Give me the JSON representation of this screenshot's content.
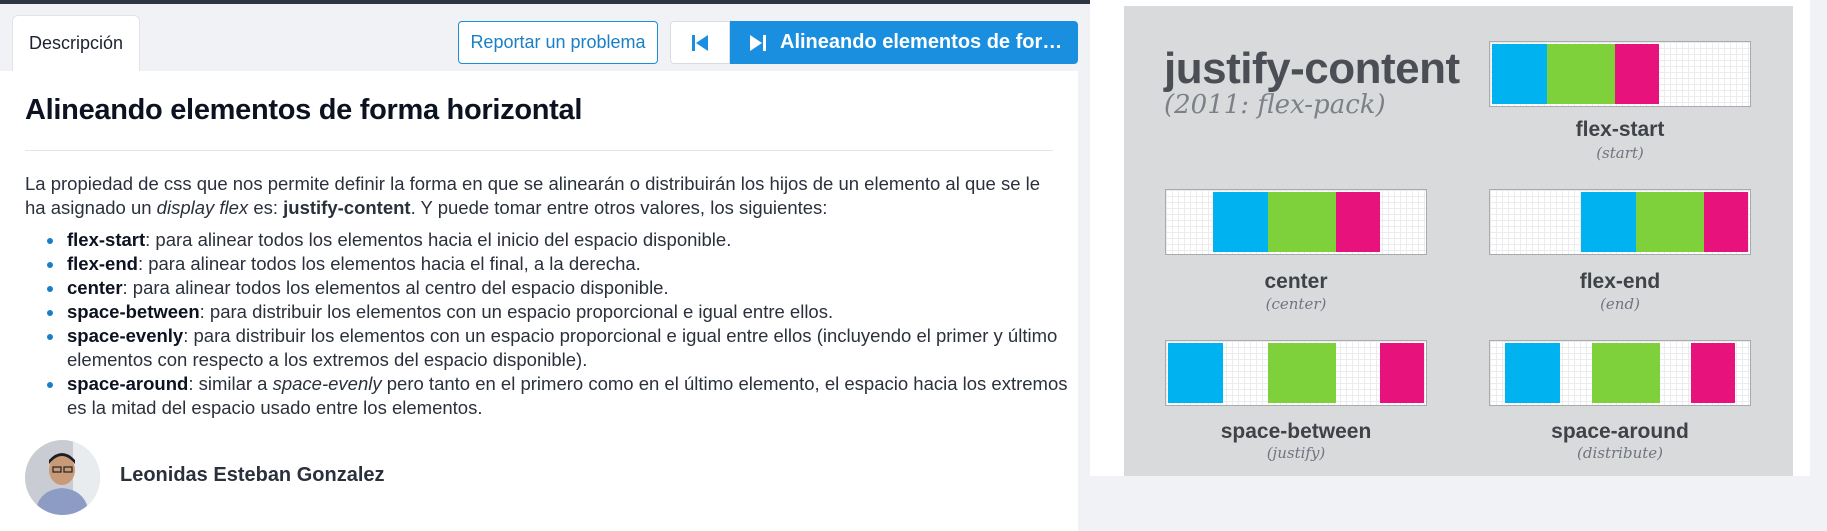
{
  "tabs": {
    "description": "Descripción"
  },
  "toolbar": {
    "report_label": "Reportar un problema",
    "next_label": "Alineando elementos de for…"
  },
  "lesson": {
    "title": "Alineando elementos de forma horizontal",
    "intro_parts": [
      "La propiedad de css que nos permite definir la forma en que se alinearán o distribuirán los hijos de un elemento al que se le ha asignado un ",
      "display flex",
      " es: ",
      "justify-content",
      ". Y puede tomar entre otros valores, los siguientes:"
    ],
    "items": [
      {
        "term": "flex-start",
        "desc": ": para alinear todos los elementos hacia el inicio del espacio disponible."
      },
      {
        "term": "flex-end",
        "desc": ": para alinear todos los elementos hacia el final, a la derecha."
      },
      {
        "term": "center",
        "desc": ": para alinear todos los elementos al centro del espacio disponible."
      },
      {
        "term": "space-between",
        "desc": ": para distribuir los elementos con un espacio proporcional e igual entre ellos."
      },
      {
        "term": "space-evenly",
        "desc": ": para distribuir los elementos con un espacio proporcional e igual entre ellos (incluyendo el primer y último elementos con respecto a los extremos del espacio disponible)."
      }
    ],
    "last_item": {
      "term": "space-around",
      "desc_a": ": similar a ",
      "desc_em": "space-evenly",
      "desc_b": " pero tanto en el primero como en el último elemento, el espacio hacia los extremos es la mitad del espacio usado entre los elementos."
    }
  },
  "author": {
    "name": "Leonidas Esteban Gonzalez",
    "avatar_icon": "user-photo"
  },
  "illustration": {
    "title": "justify-content",
    "subtitle": "(2011: flex-pack)",
    "colors": {
      "blue": "#00b3f0",
      "green": "#7fd13b",
      "pink": "#e8127c"
    },
    "panels": [
      {
        "label": "flex-start",
        "sub": "(start)"
      },
      {
        "label": "center",
        "sub": "(center)"
      },
      {
        "label": "flex-end",
        "sub": "(end)"
      },
      {
        "label": "space-between",
        "sub": "(justify)"
      },
      {
        "label": "space-around",
        "sub": "(distribute)"
      }
    ]
  },
  "accent_color": "#1a8fe0"
}
